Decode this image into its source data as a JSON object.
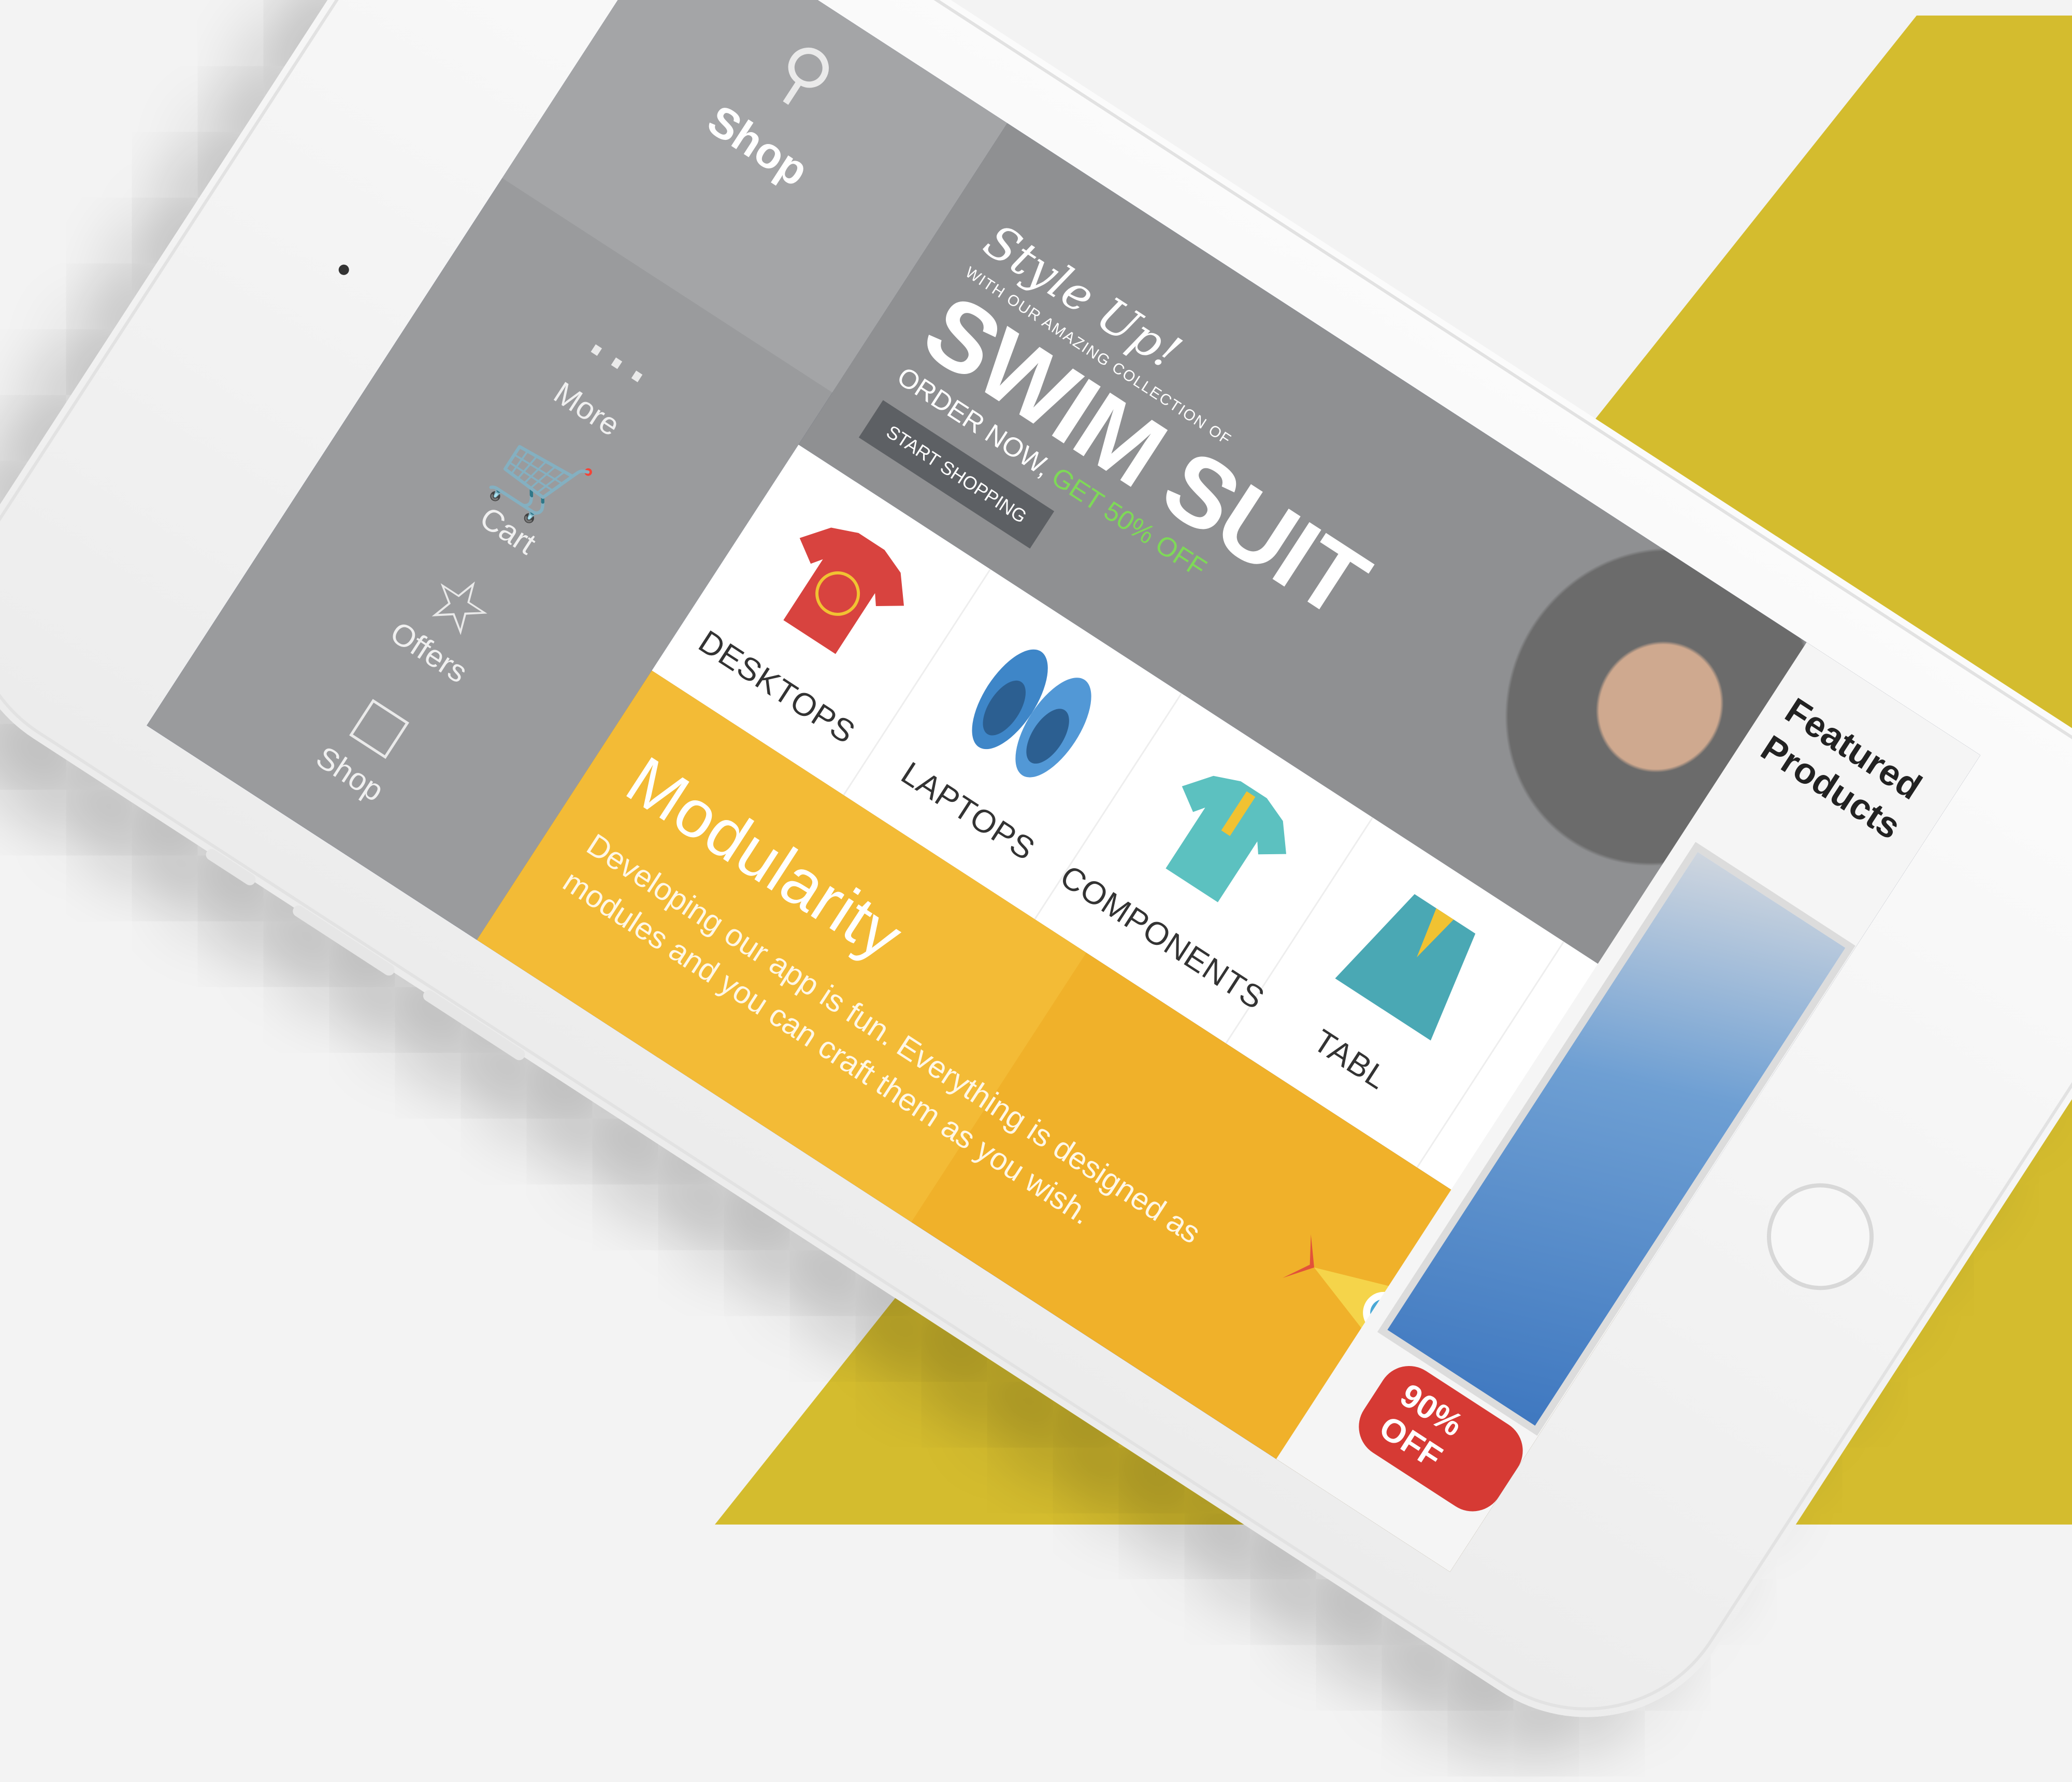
{
  "nav": {
    "title": "Shop",
    "items": [
      {
        "label": "Shop",
        "icon": "price-tag-icon"
      },
      {
        "label": "Offers",
        "icon": "star-icon"
      },
      {
        "label": "Cart",
        "icon": "cart-icon"
      },
      {
        "label": "More",
        "icon": "more-dots-icon"
      }
    ],
    "search_icon": "search-icon"
  },
  "hero": {
    "script": "Style Up!",
    "small": "WITH OUR AMAZING COLLECTION OF",
    "big": "SWIM SUIT",
    "order": "ORDER NOW,",
    "order_off": "GET 50% OFF",
    "button": "START SHOPPING"
  },
  "categories": [
    {
      "label": "DESKTOPS",
      "icon": "red-tshirt-icon"
    },
    {
      "label": "LAPTOPS",
      "icon": "blue-shoes-icon"
    },
    {
      "label": "COMPONENTS",
      "icon": "teal-polo-icon"
    },
    {
      "label": "TABL",
      "icon": "suit-icon"
    }
  ],
  "banner": {
    "title": "Modularity",
    "text": "Developing our app is fun. Everything is designed as modules and you can craft them as you wish."
  },
  "featured": {
    "title": "Featured Products",
    "badge": "90% OFF"
  },
  "colors": {
    "background": "#f3f3f3",
    "stripe": "#d4bc2e",
    "screen_bg": "#1d2e5a",
    "banner": "#f0b12a",
    "badge": "#d63a34"
  }
}
